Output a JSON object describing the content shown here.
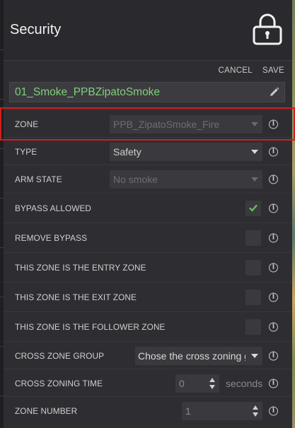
{
  "header": {
    "title": "Security",
    "icon": "lock-icon"
  },
  "actions": {
    "cancel": "CANCEL",
    "save": "SAVE"
  },
  "device": {
    "name": "01_Smoke_PPBZipatoSmoke",
    "name_color": "#7fd07a",
    "edit_icon": "pencil-icon"
  },
  "rows": {
    "zone": {
      "label": "ZONE",
      "value": "PPB_ZipatoSmoke_Fire",
      "disabled": true,
      "highlighted": true
    },
    "type": {
      "label": "TYPE",
      "value": "Safety"
    },
    "arm_state": {
      "label": "ARM STATE",
      "value": "No smoke",
      "disabled": true
    },
    "bypass_allowed": {
      "label": "BYPASS ALLOWED",
      "checked": true,
      "check_color": "#6dc55f"
    },
    "remove_bypass": {
      "label": "REMOVE BYPASS",
      "checked": false
    },
    "entry_zone": {
      "label": "THIS ZONE IS THE ENTRY ZONE",
      "checked": false
    },
    "exit_zone": {
      "label": "THIS ZONE IS THE EXIT ZONE",
      "checked": false
    },
    "follower_zone": {
      "label": "THIS ZONE IS THE FOLLOWER ZONE",
      "checked": false
    },
    "cross_zone_group": {
      "label": "CROSS ZONE GROUP",
      "value": "Chose the cross zoning group"
    },
    "cross_zoning_time": {
      "label": "CROSS ZONING TIME",
      "value": "0",
      "unit": "seconds"
    },
    "zone_number": {
      "label": "ZONE NUMBER",
      "value": "1"
    }
  },
  "colors": {
    "highlight": "#d01e1e",
    "panel": "#2e2e32",
    "field": "#3a3a3e"
  }
}
